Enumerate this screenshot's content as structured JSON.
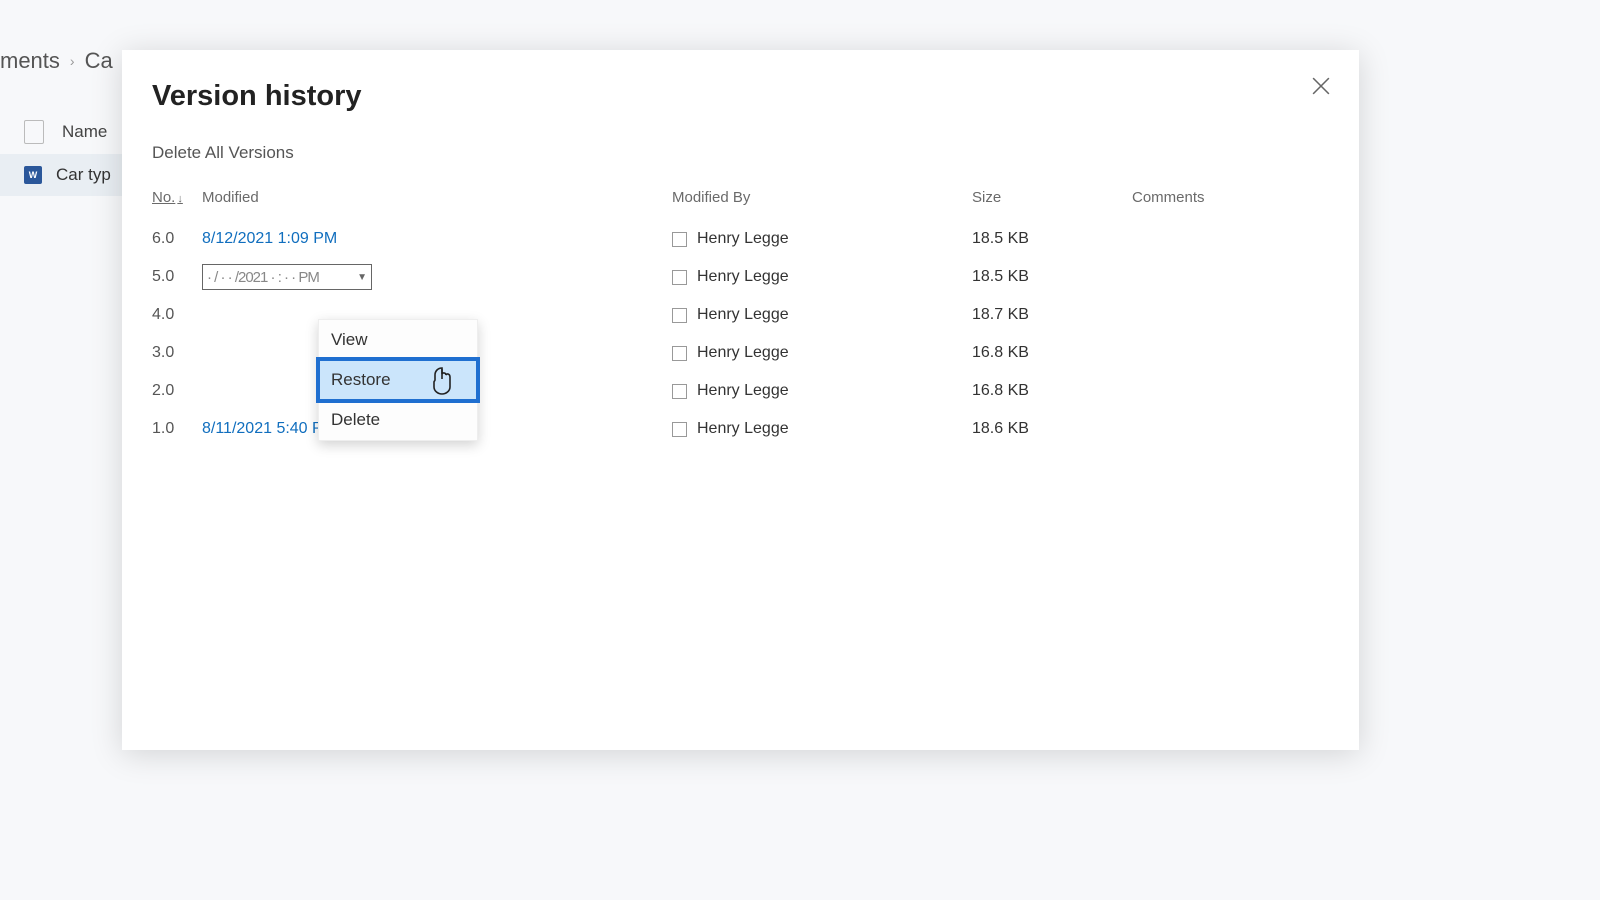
{
  "background": {
    "breadcrumb_prev": "ments",
    "breadcrumb_current": "Ca",
    "name_header": "Name",
    "file_name": "Car typ"
  },
  "panel": {
    "title": "Version history",
    "delete_all": "Delete All Versions",
    "headers": {
      "no": "No.",
      "modified": "Modified",
      "modified_by": "Modified By",
      "size": "Size",
      "comments": "Comments"
    },
    "rows": [
      {
        "no": "6.0",
        "modified": "8/12/2021 1:09 PM",
        "modified_by": "Henry Legge",
        "size": "18.5 KB",
        "comments": ""
      },
      {
        "no": "5.0",
        "modified": "",
        "modified_by": "Henry Legge",
        "size": "18.5 KB",
        "comments": ""
      },
      {
        "no": "4.0",
        "modified": "",
        "modified_by": "Henry Legge",
        "size": "18.7 KB",
        "comments": ""
      },
      {
        "no": "3.0",
        "modified": "",
        "modified_by": "Henry Legge",
        "size": "16.8 KB",
        "comments": ""
      },
      {
        "no": "2.0",
        "modified": "",
        "modified_by": "Henry Legge",
        "size": "16.8 KB",
        "comments": ""
      },
      {
        "no": "1.0",
        "modified": "8/11/2021 5:40 PM",
        "modified_by": "Henry Legge",
        "size": "18.6 KB",
        "comments": ""
      }
    ],
    "dropdown_hint": "· / · · /2021 · : · · PM",
    "menu": {
      "view": "View",
      "restore": "Restore",
      "delete": "Delete"
    }
  }
}
